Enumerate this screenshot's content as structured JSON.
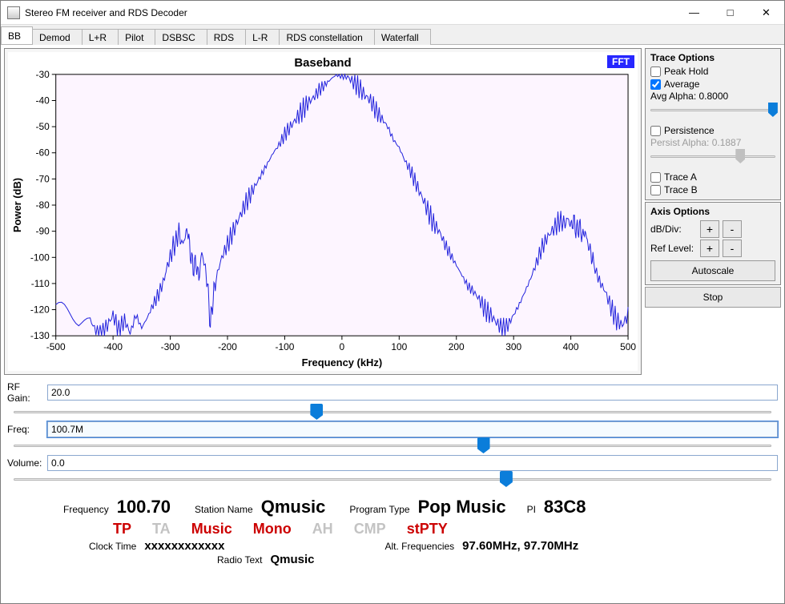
{
  "window": {
    "title": "Stereo FM receiver and RDS Decoder"
  },
  "tabs": [
    "BB",
    "Demod",
    "L+R",
    "Pilot",
    "DSBSC",
    "RDS",
    "L-R",
    "RDS constellation",
    "Waterfall"
  ],
  "active_tab": 0,
  "fft_badge": "FFT",
  "trace_options": {
    "title": "Trace Options",
    "peak_hold": {
      "label": "Peak Hold",
      "checked": false
    },
    "average": {
      "label": "Average",
      "checked": true
    },
    "avg_alpha_label": "Avg Alpha: 0.8000",
    "avg_slider_pos": 98,
    "persistence": {
      "label": "Persistence",
      "checked": false
    },
    "persist_alpha_label": "Persist Alpha: 0.1887",
    "persist_slider_pos": 72,
    "trace_a": {
      "label": "Trace A",
      "checked": false
    },
    "trace_b": {
      "label": "Trace B",
      "checked": false
    }
  },
  "axis_options": {
    "title": "Axis Options",
    "db_div_label": "dB/Div:",
    "ref_level_label": "Ref Level:",
    "autoscale": "Autoscale",
    "stop": "Stop"
  },
  "controls": {
    "rf_gain": {
      "label": "RF Gain:",
      "value": "20.0",
      "slider_pos": 40
    },
    "freq": {
      "label": "Freq:",
      "value": "100.7M",
      "slider_pos": 62
    },
    "volume": {
      "label": "Volume:",
      "value": "0.0",
      "slider_pos": 65
    }
  },
  "status": {
    "freq_label": "Frequency",
    "freq_val": "100.70",
    "station_label": "Station Name",
    "station_val": "Qmusic",
    "ptype_label": "Program Type",
    "ptype_val": "Pop Music",
    "pi_label": "PI",
    "pi_val": "83C8",
    "flags": {
      "tp": "TP",
      "ta": "TA",
      "music": "Music",
      "mono": "Mono",
      "ah": "AH",
      "cmp": "CMP",
      "stpty": "stPTY"
    },
    "clock_label": "Clock Time",
    "clock_val": "xxxxxxxxxxxx",
    "altf_label": "Alt. Frequencies",
    "altf_val": "97.60MHz, 97.70MHz",
    "radio_text_label": "Radio Text",
    "radio_text_val": "Qmusic"
  },
  "chart_data": {
    "type": "line",
    "title": "Baseband",
    "xlabel": "Frequency (kHz)",
    "ylabel": "Power (dB)",
    "xlim": [
      -500,
      500
    ],
    "ylim": [
      -130,
      -30
    ],
    "xticks": [
      -500,
      -400,
      -300,
      -200,
      -100,
      0,
      100,
      200,
      300,
      400,
      500
    ],
    "yticks": [
      -130,
      -120,
      -110,
      -100,
      -90,
      -80,
      -70,
      -60,
      -50,
      -40,
      -30
    ],
    "series": [
      {
        "name": "Baseband",
        "x": [
          -500,
          -480,
          -460,
          -440,
          -430,
          -420,
          -410,
          -400,
          -390,
          -380,
          -370,
          -360,
          -350,
          -340,
          -330,
          -320,
          -310,
          -305,
          -300,
          -295,
          -290,
          -285,
          -280,
          -275,
          -270,
          -265,
          -260,
          -255,
          -250,
          -245,
          -240,
          -235,
          -230,
          -225,
          -220,
          -210,
          -200,
          -190,
          -180,
          -170,
          -160,
          -150,
          -140,
          -130,
          -120,
          -110,
          -100,
          -90,
          -80,
          -70,
          -60,
          -50,
          -40,
          -30,
          -20,
          -10,
          0,
          10,
          20,
          30,
          40,
          50,
          60,
          70,
          80,
          90,
          100,
          110,
          120,
          130,
          140,
          150,
          160,
          170,
          180,
          190,
          200,
          210,
          220,
          230,
          240,
          250,
          260,
          270,
          280,
          290,
          300,
          310,
          320,
          330,
          340,
          350,
          360,
          370,
          380,
          390,
          395,
          400,
          405,
          410,
          415,
          420,
          425,
          430,
          435,
          440,
          450,
          460,
          470,
          480,
          490,
          500
        ],
        "y": [
          -118,
          -122,
          -126,
          -124,
          -128,
          -130,
          -126,
          -122,
          -128,
          -124,
          -129,
          -122,
          -127,
          -123,
          -118,
          -114,
          -108,
          -103,
          -100,
          -96,
          -94,
          -90,
          -95,
          -93,
          -89,
          -98,
          -104,
          -102,
          -108,
          -98,
          -103,
          -110,
          -126,
          -115,
          -108,
          -100,
          -95,
          -90,
          -85,
          -80,
          -76,
          -72,
          -68,
          -64,
          -60,
          -57,
          -53,
          -50,
          -47,
          -44,
          -41,
          -39,
          -36,
          -34,
          -32,
          -30,
          -30,
          -31,
          -33,
          -35,
          -38,
          -40,
          -44,
          -47,
          -50,
          -55,
          -58,
          -63,
          -67,
          -72,
          -77,
          -82,
          -87,
          -90,
          -95,
          -99,
          -103,
          -107,
          -111,
          -113,
          -116,
          -120,
          -122,
          -125,
          -127,
          -126,
          -122,
          -118,
          -113,
          -108,
          -102,
          -96,
          -92,
          -89,
          -86,
          -87,
          -85,
          -88,
          -86,
          -90,
          -88,
          -92,
          -90,
          -95,
          -98,
          -103,
          -109,
          -113,
          -119,
          -124,
          -126,
          -122
        ]
      }
    ]
  }
}
